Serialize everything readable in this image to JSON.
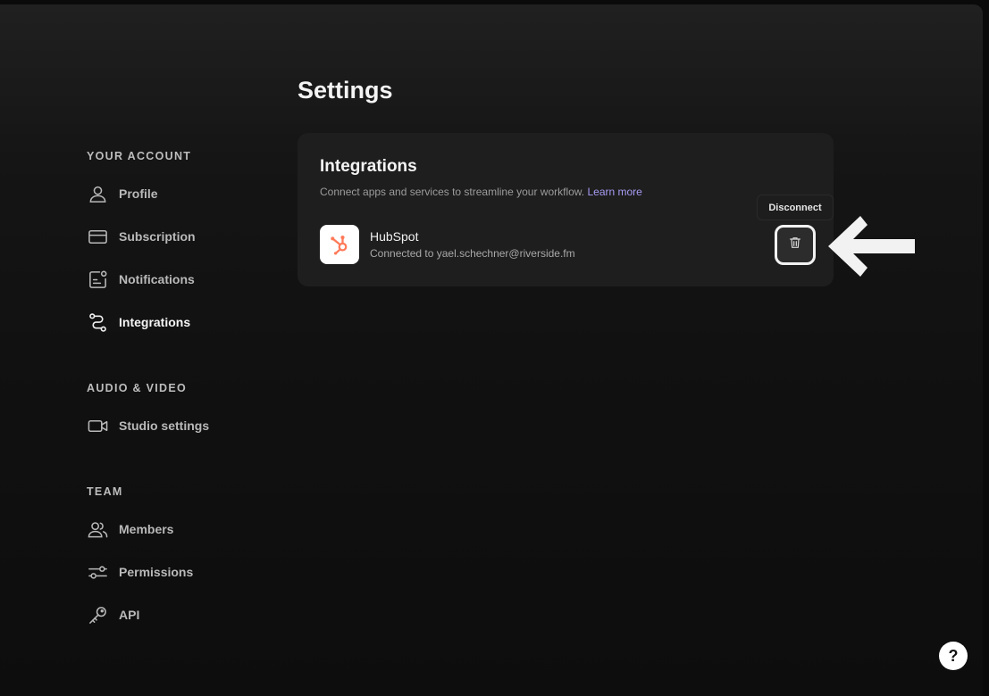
{
  "page": {
    "title": "Settings"
  },
  "sidebar": {
    "sections": [
      {
        "heading": "YOUR ACCOUNT"
      },
      {
        "heading": "AUDIO & VIDEO"
      },
      {
        "heading": "TEAM"
      }
    ],
    "items": [
      {
        "label": "Profile",
        "icon": "user-icon"
      },
      {
        "label": "Subscription",
        "icon": "credit-card-icon"
      },
      {
        "label": "Notifications",
        "icon": "notification-icon"
      },
      {
        "label": "Integrations",
        "icon": "integrations-icon",
        "active": true
      },
      {
        "label": "Studio settings",
        "icon": "video-camera-icon"
      },
      {
        "label": "Members",
        "icon": "users-icon"
      },
      {
        "label": "Permissions",
        "icon": "sliders-icon"
      },
      {
        "label": "API",
        "icon": "key-icon"
      }
    ]
  },
  "integrations": {
    "title": "Integrations",
    "description": "Connect apps and services to streamline your workflow.",
    "learn_more": "Learn more",
    "items": [
      {
        "name": "HubSpot",
        "status": "Connected to yael.schechner@riverside.fm",
        "icon": "hubspot-logo",
        "brand_color": "#ff7a59"
      }
    ],
    "disconnect_tooltip": "Disconnect"
  },
  "help": {
    "label": "?"
  },
  "colors": {
    "accent": "#a79cf3",
    "background": "#0a0a0a",
    "card": "#1e1e1e"
  }
}
